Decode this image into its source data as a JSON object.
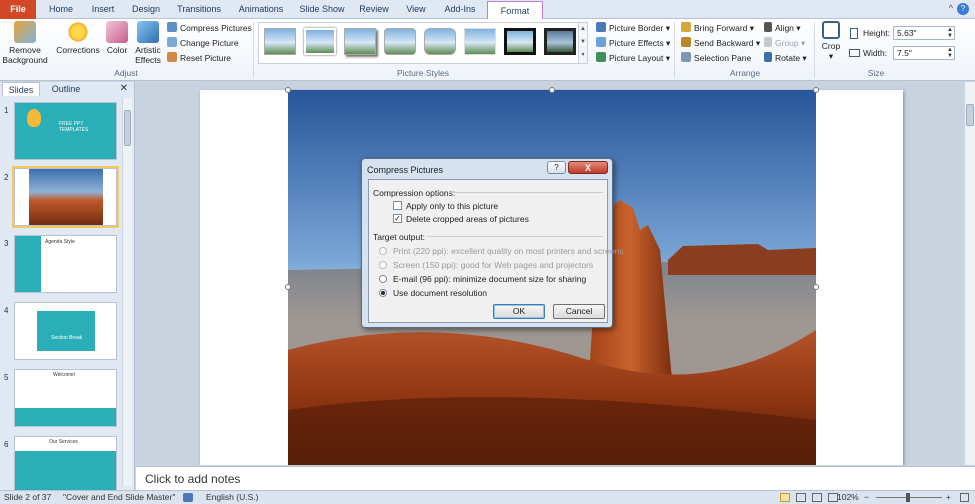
{
  "ribbon_tabs": [
    "File",
    "Home",
    "Insert",
    "Design",
    "Transitions",
    "Animations",
    "Slide Show",
    "Review",
    "View",
    "Add-Ins",
    "Format"
  ],
  "active_tab": "Format",
  "adjust": {
    "remove_background": "Remove Background",
    "corrections": "Corrections",
    "color": "Color",
    "artistic_effects": "Artistic Effects",
    "compress_pictures": "Compress Pictures",
    "change_picture": "Change Picture",
    "reset_picture": "Reset Picture",
    "label": "Adjust"
  },
  "picture_styles": {
    "label": "Picture Styles",
    "picture_border": "Picture Border",
    "picture_effects": "Picture Effects",
    "picture_layout": "Picture Layout"
  },
  "arrange": {
    "label": "Arrange",
    "bring_forward": "Bring Forward",
    "send_backward": "Send Backward",
    "selection_pane": "Selection Pane",
    "align": "Align",
    "group": "Group",
    "rotate": "Rotate"
  },
  "size": {
    "label": "Size",
    "crop": "Crop",
    "height_label": "Height:",
    "height_value": "5.63\"",
    "width_label": "Width:",
    "width_value": "7.5\""
  },
  "panel": {
    "slides_tab": "Slides",
    "outline_tab": "Outline",
    "slide_numbers": [
      "1",
      "2",
      "3",
      "4",
      "5",
      "6"
    ],
    "thumb1_title": "FREE PPT TEMPLATES",
    "thumb3_title": "Agenda Style",
    "thumb4_title": "Section Break",
    "thumb5_title": "Welcome!",
    "thumb6_title": "Our Services"
  },
  "notes_placeholder": "Click to add notes",
  "status": {
    "slide_info": "Slide 2 of 37",
    "theme": "\"Cover and End Slide Master\"",
    "language": "English (U.S.)",
    "zoom": "102%"
  },
  "dialog": {
    "title": "Compress Pictures",
    "help": "?",
    "close": "X",
    "compression_options": "Compression options:",
    "apply_only": "Apply only to this picture",
    "delete_cropped": "Delete cropped areas of pictures",
    "target_output": "Target output:",
    "print_option": "Print (220 ppi): excellent quality on most printers and screens",
    "screen_option": "Screen (150 ppi): good for Web pages and projectors",
    "email_option": "E-mail (96 ppi): minimize document size for sharing",
    "document_option": "Use document resolution",
    "ok": "OK",
    "cancel": "Cancel"
  }
}
